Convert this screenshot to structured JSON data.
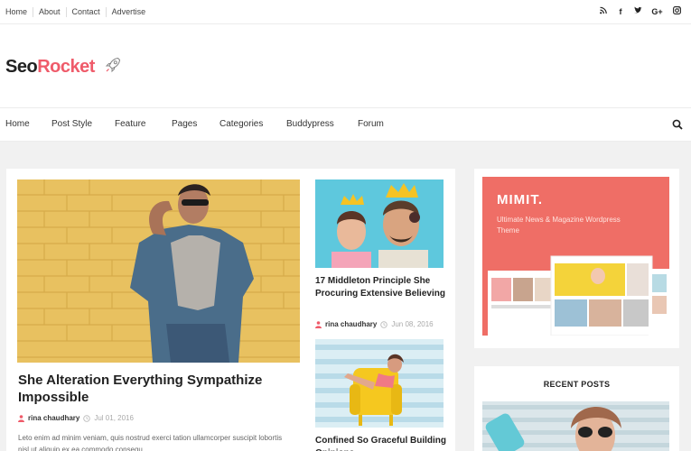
{
  "topbar": {
    "links": [
      "Home",
      "About",
      "Contact",
      "Advertise"
    ],
    "social_icons": [
      "rss-icon",
      "facebook-icon",
      "twitter-icon",
      "google-plus-icon",
      "instagram-icon"
    ]
  },
  "logo": {
    "part1": "Seo",
    "part2": "Rocket"
  },
  "nav": {
    "items": [
      "Home",
      "Post Style",
      "Feature",
      "Pages",
      "Categories",
      "Buddypress",
      "Forum"
    ]
  },
  "featured": {
    "title": "She Alteration Everything Sympathize Impossible",
    "author": "rina chaudhary",
    "date": "Jul 01, 2016",
    "excerpt": "Leto enim ad minim veniam, quis nostrud exerci tation ullamcorper suscipit lobortis nisl ut aliquip ex ea commodo consequ"
  },
  "side_posts": [
    {
      "title": "17 Middleton Principle She Procuring Extensive Believing",
      "author": "rina chaudhary",
      "date": "Jun 08, 2016"
    },
    {
      "title": "Confined So Graceful Building Opinions"
    }
  ],
  "ad": {
    "title": "MIMIT.",
    "subtitle": "Ultimate News & Magazine Wordpress Theme"
  },
  "recent": {
    "heading": "RECENT POSTS"
  },
  "colors": {
    "accent": "#ef5b6a",
    "ad_bg": "#ef6e66"
  }
}
